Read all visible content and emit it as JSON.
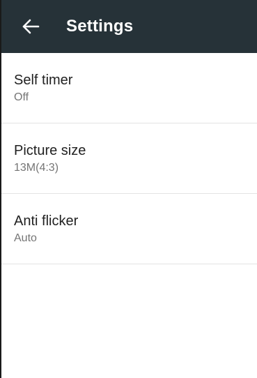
{
  "app_bar": {
    "title": "Settings",
    "back_icon": "arrow-left-icon",
    "background_color": "#263238"
  },
  "settings": [
    {
      "title": "Self timer",
      "value": "Off"
    },
    {
      "title": "Picture size",
      "value": "13M(4:3)"
    },
    {
      "title": "Anti flicker",
      "value": "Auto"
    }
  ]
}
